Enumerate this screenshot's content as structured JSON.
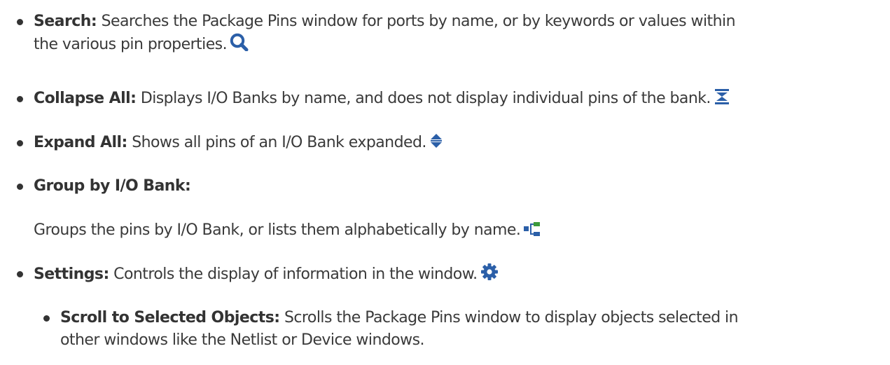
{
  "items": [
    {
      "term": "Search:",
      "line1": " Searches the Package Pins window for ports by name, or by keywords or values within",
      "line2": "the various pin properties.",
      "icon": "search-icon"
    },
    {
      "term": "Collapse All:",
      "line1": " Displays I/O Banks by name, and does not display individual pins of the bank.",
      "icon": "collapse-all-icon"
    },
    {
      "term": "Expand All:",
      "line1": " Shows all pins of an I/O Bank expanded.",
      "icon": "expand-all-icon"
    },
    {
      "term": "Group by I/O Bank:",
      "paragraph": "Groups the pins by I/O Bank, or lists them alphabetically by name.",
      "icon": "group-by-bank-icon"
    },
    {
      "term": "Settings:",
      "line1": " Controls the display of information in the window.",
      "icon": "gear-icon"
    }
  ],
  "sub_items": [
    {
      "term": "Scroll to Selected Objects:",
      "line1": " Scrolls the Package Pins window to display objects selected in",
      "line2": "other windows like the Netlist or Device windows."
    }
  ],
  "colors": {
    "text": "#3a3a3a",
    "icon_blue": "#2b5fa8",
    "icon_green": "#3c9a3c"
  }
}
